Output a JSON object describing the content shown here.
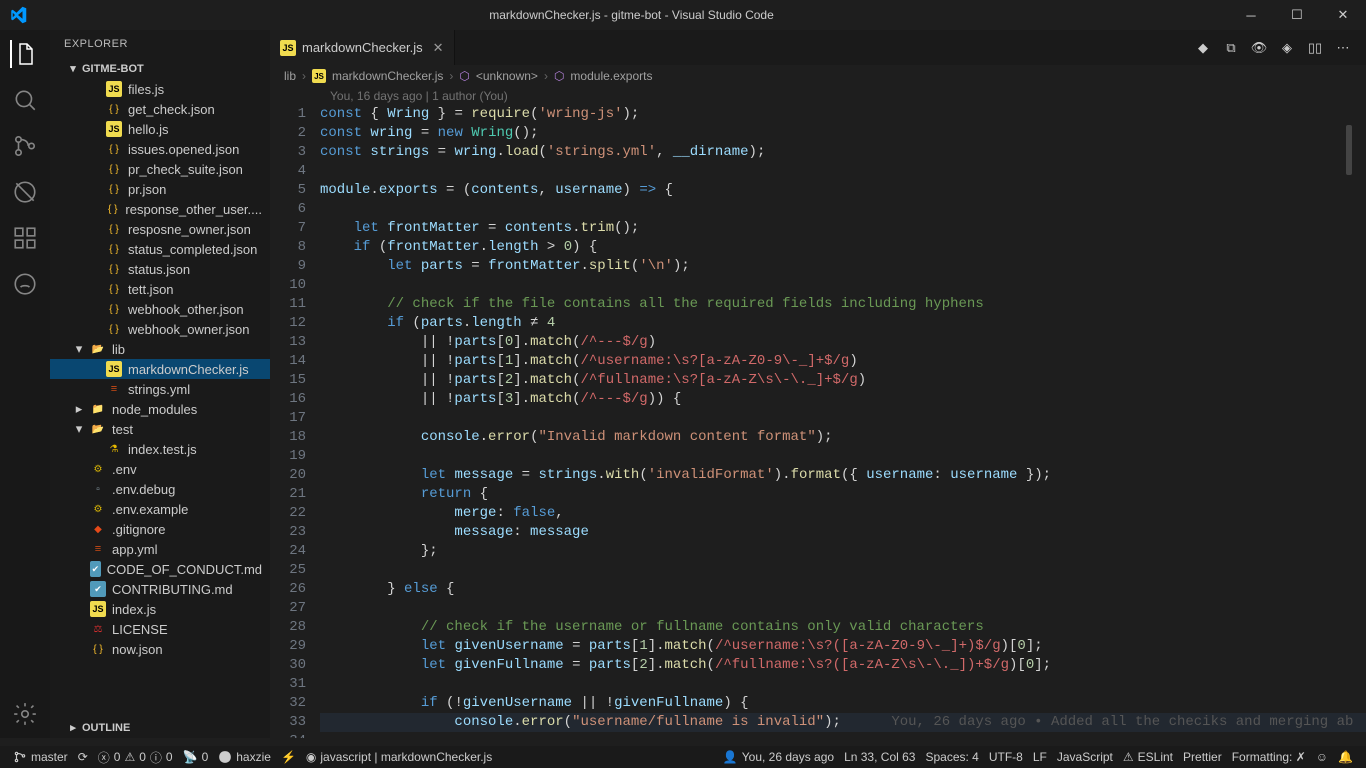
{
  "window": {
    "title": "markdownChecker.js - gitme-bot - Visual Studio Code"
  },
  "sidebar": {
    "header": "EXPLORER",
    "project": "GITME-BOT",
    "outline": "OUTLINE",
    "items": [
      {
        "name": "files.js",
        "type": "js",
        "indent": "indent2"
      },
      {
        "name": "get_check.json",
        "type": "json",
        "indent": "indent2"
      },
      {
        "name": "hello.js",
        "type": "js",
        "indent": "indent2"
      },
      {
        "name": "issues.opened.json",
        "type": "json",
        "indent": "indent2"
      },
      {
        "name": "pr_check_suite.json",
        "type": "json",
        "indent": "indent2"
      },
      {
        "name": "pr.json",
        "type": "json",
        "indent": "indent2"
      },
      {
        "name": "response_other_user....",
        "type": "json",
        "indent": "indent2"
      },
      {
        "name": "resposne_owner.json",
        "type": "json",
        "indent": "indent2"
      },
      {
        "name": "status_completed.json",
        "type": "json",
        "indent": "indent2"
      },
      {
        "name": "status.json",
        "type": "json",
        "indent": "indent2"
      },
      {
        "name": "tett.json",
        "type": "json",
        "indent": "indent2"
      },
      {
        "name": "webhook_other.json",
        "type": "json",
        "indent": "indent2"
      },
      {
        "name": "webhook_owner.json",
        "type": "json",
        "indent": "indent2"
      },
      {
        "name": "lib",
        "type": "folder-open",
        "indent": "fold",
        "color": ""
      },
      {
        "name": "markdownChecker.js",
        "type": "js",
        "indent": "indent2",
        "selected": true
      },
      {
        "name": "strings.yml",
        "type": "yml",
        "indent": "indent2"
      },
      {
        "name": "node_modules",
        "type": "folder-closed",
        "indent": "fold",
        "color": "green"
      },
      {
        "name": "test",
        "type": "folder-open",
        "indent": "fold",
        "color": "teal"
      },
      {
        "name": "index.test.js",
        "type": "test",
        "indent": "indent2"
      },
      {
        "name": ".env",
        "type": "env",
        "indent": "indent1"
      },
      {
        "name": ".env.debug",
        "type": "file",
        "indent": "indent1"
      },
      {
        "name": ".env.example",
        "type": "env",
        "indent": "indent1"
      },
      {
        "name": ".gitignore",
        "type": "git",
        "indent": "indent1"
      },
      {
        "name": "app.yml",
        "type": "yml",
        "indent": "indent1"
      },
      {
        "name": "CODE_OF_CONDUCT.md",
        "type": "md",
        "indent": "indent1"
      },
      {
        "name": "CONTRIBUTING.md",
        "type": "md",
        "indent": "indent1"
      },
      {
        "name": "index.js",
        "type": "js",
        "indent": "indent1"
      },
      {
        "name": "LICENSE",
        "type": "lic",
        "indent": "indent1"
      },
      {
        "name": "now.json",
        "type": "json",
        "indent": "indent1"
      }
    ]
  },
  "tab": {
    "name": "markdownChecker.js"
  },
  "breadcrumb": {
    "p1": "lib",
    "p2": "markdownChecker.js",
    "p3": "<unknown>",
    "p4": "module.exports"
  },
  "blame": "You, 16 days ago | 1 author (You)",
  "inline_blame": "You, 26 days ago • Added all the checiks and merging ab",
  "lines_start": 1,
  "lines_end": 34,
  "status": {
    "branch": "master",
    "sync": "",
    "errors": "0",
    "warnings": "0",
    "info": "0",
    "broadcast": "0",
    "user": "haxzie",
    "lang_left": "javascript | markdownChecker.js",
    "blame": "You, 26 days ago",
    "pos": "Ln 33, Col 63",
    "spaces": "Spaces: 4",
    "enc": "UTF-8",
    "eol": "LF",
    "lang": "JavaScript",
    "eslint": "ESLint",
    "prettier": "Prettier",
    "formatting": "Formatting: ✗"
  }
}
